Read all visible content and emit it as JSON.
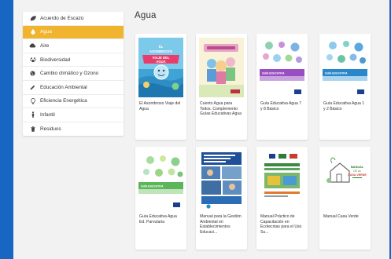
{
  "sidebar": {
    "items": [
      {
        "label": "Acuerdo de Escazú",
        "icon": "leaf-icon",
        "active": false
      },
      {
        "label": "Agua",
        "icon": "water-drop-icon",
        "active": true
      },
      {
        "label": "Aire",
        "icon": "cloud-icon",
        "active": false
      },
      {
        "label": "Biodiversidad",
        "icon": "paw-icon",
        "active": false
      },
      {
        "label": "Cambio climático y Ozono",
        "icon": "globe-icon",
        "active": false
      },
      {
        "label": "Educación Ambiental",
        "icon": "pencil-icon",
        "active": false
      },
      {
        "label": "Eficiencia Energética",
        "icon": "lightbulb-icon",
        "active": false
      },
      {
        "label": "Infantil",
        "icon": "child-icon",
        "active": false
      },
      {
        "label": "Residuos",
        "icon": "trash-icon",
        "active": false
      }
    ],
    "active_color": "#f0b42f"
  },
  "main": {
    "title": "Agua",
    "cards": [
      {
        "caption": "El Asombroso Viaje del Agua",
        "cover_text": "EL ASOMBROSO VIAJE DEL AGUA"
      },
      {
        "caption": "Cuento Agua para Todos. Complemento Guías Educativas Agua",
        "cover_text": ""
      },
      {
        "caption": "Guía Educativa Agua 7 y 8 Básico",
        "cover_text": "GUÍA EDUCATIVA"
      },
      {
        "caption": "Guía Educativa Agua 1 y 2 Básico",
        "cover_text": "GUÍA EDUCATIVA"
      },
      {
        "caption": "Guía Educativa Agua Ed. Parvularia",
        "cover_text": "GUÍA EDUCATIVA"
      },
      {
        "caption": "Manual para la Gestión Ambiental en Establecimientos Educaci...",
        "cover_text": ""
      },
      {
        "caption": "Manual Práctico de Capacitación en Ecotecnias para el Uso Su...",
        "cover_text": ""
      },
      {
        "caption": "Manual Casa Verde",
        "cover_text": "MANUAL DE LA CASA VERDE"
      }
    ]
  },
  "colors": {
    "frame_blue": "#1766c2",
    "panel_bg": "#f2f2f2"
  }
}
